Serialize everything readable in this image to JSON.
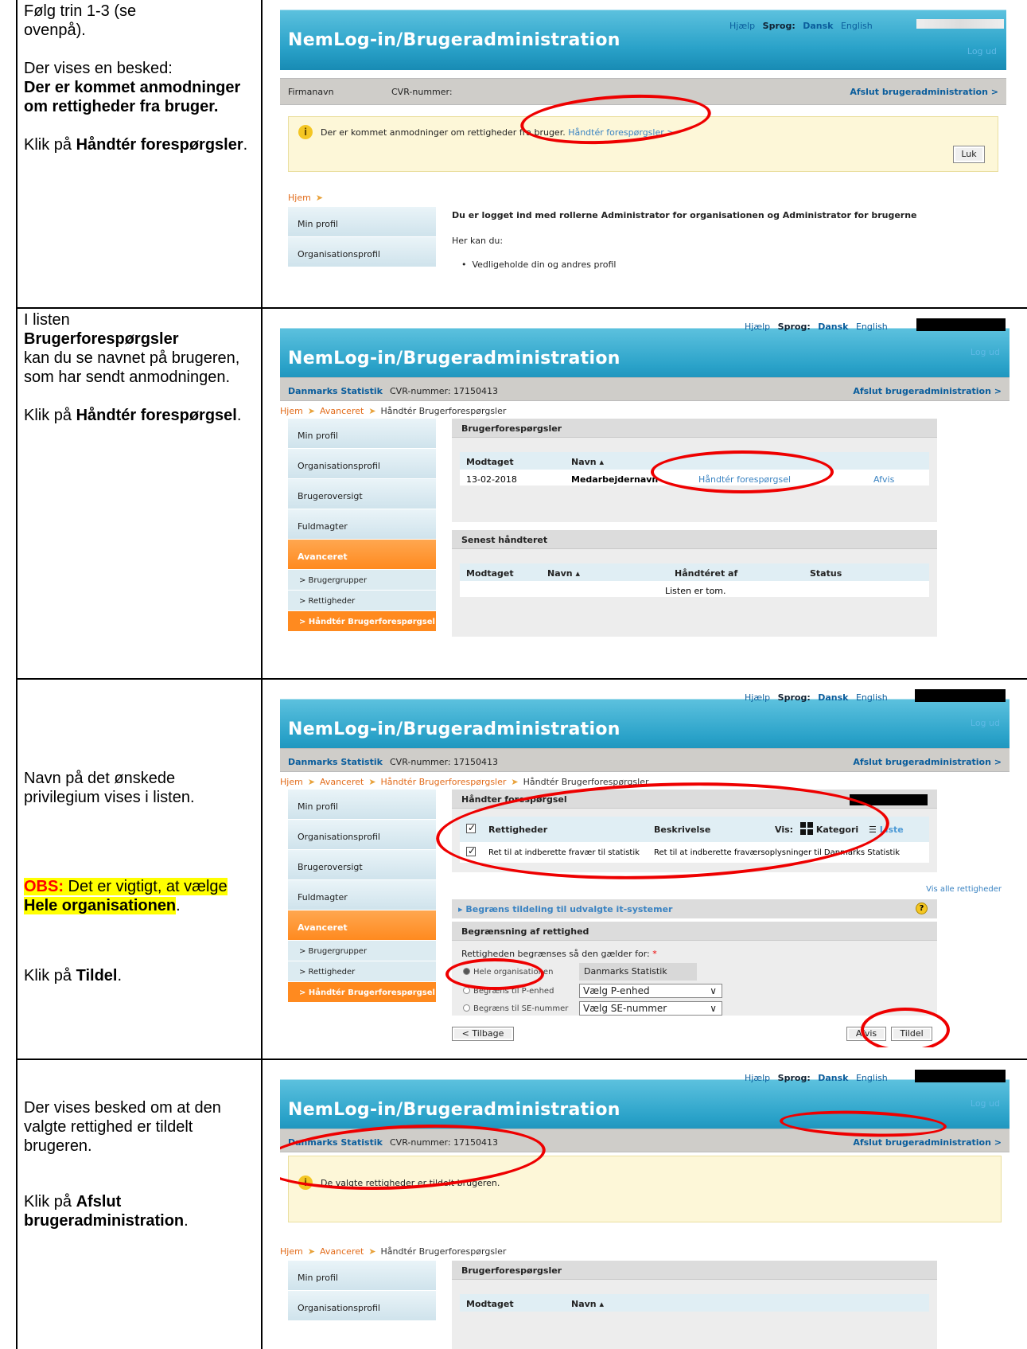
{
  "common": {
    "app_title": "NemLog-in/Brugeradministration",
    "help": "Hjælp",
    "language_label": "Sprog:",
    "lang_dk": "Dansk",
    "lang_en": "English",
    "logout": "Log ud",
    "cvr_label": "CVR-nummer:",
    "exit_admin": "Afslut brugeradministration >",
    "breadcrumb_home": "Hjem",
    "breadcrumb_adv": "Avanceret",
    "breadcrumb_handle": "Håndtér Brugerforespørgsler",
    "nav": {
      "my_profile": "Min profil",
      "org_profile": "Organisationsprofil",
      "user_overview": "Brugeroversigt",
      "mandates": "Fuldmagter",
      "advanced": "Avanceret",
      "groups": "> Brugergrupper",
      "rights": "> Rettigheder",
      "handle_requests": "> Håndtér Brugerforespørgsel"
    }
  },
  "steps": [
    {
      "text_1": "Følg trin 1-3 (se ovenpå).",
      "text_2": "Der vises en besked:",
      "text_3": "Der er kommet anmodninger om rettigheder fra bruger.",
      "text_4a": "Klik på ",
      "text_4b": "Håndtér forespørgsler",
      "text_4c": ".",
      "shot": {
        "org_name": "Firmanavn",
        "info_text": "Der er kommet anmodninger om rettigheder fra bruger.",
        "info_link": "Håndtér forespørgsler >",
        "close_button": "Luk",
        "login_roles": "Du er logget ind med rollerne Administrator for organisationen og Administrator for brugerne",
        "here_you_can": "Her kan du:",
        "bullet_1": "Vedligeholde din og andres profil"
      }
    },
    {
      "text_1": "I listen",
      "text_2": "Brugerforespørgsler",
      "text_3": "kan du se navnet på brugeren, som har sendt anmodningen.",
      "text_4a": "Klik på ",
      "text_4b": "Håndtér forespørgsel",
      "text_4c": ".",
      "shot": {
        "org_name": "Danmarks Statistik",
        "cvr": "CVR-nummer: 17150413",
        "panel1_title": "Brugerforespørgsler",
        "col_received": "Modtaget",
        "col_name": "Navn ▴",
        "row_date": "13-02-2018",
        "row_name": "Medarbejdernavn",
        "row_handle": "Håndtér forespørgsel",
        "row_reject": "Afvis",
        "panel2_title": "Senest håndteret",
        "col_handled_by": "Håndtéret af",
        "col_status": "Status",
        "empty": "Listen er tom."
      }
    },
    {
      "text_1": "Navn på det ønskede privilegium vises i listen.",
      "obs_label": "OBS:",
      "obs_text_1": " Det er vigtigt, at vælge ",
      "obs_bold": "Hele organisationen",
      "obs_text_2": ".",
      "text_4a": "Klik på ",
      "text_4b": "Tildel",
      "text_4c": ".",
      "shot": {
        "org_name": "Danmarks Statistik",
        "cvr": "CVR-nummer: 17150413",
        "panel_title": "Håndter forespørgsel",
        "col_rights": "Rettigheder",
        "col_desc": "Beskrivelse",
        "view_label": "Vis:",
        "view_category": "Kategori",
        "view_list": "Liste",
        "right_name": "Ret til at indberette fravær til statistik",
        "right_desc": "Ret til at indberette fraværsoplysninger til Danmarks Statistik",
        "show_all": "Vis alle rettigheder",
        "limit_systems": "▸ Begræns tildeling til udvalgte it-systemer",
        "limit_title": "Begrænsning af rettighed",
        "limit_text": "Rettigheden begrænses så den gælder for:",
        "opt_whole": "Hele organisationen",
        "opt_p": "Begræns til P-enhed",
        "opt_se": "Begræns til SE-nummer",
        "org_value": "Danmarks Statistik",
        "select_p": "Vælg P-enhed",
        "select_se": "Vælg SE-nummer",
        "back_button": "< Tilbage",
        "reject_button": "Afvis",
        "assign_button": "Tildel"
      }
    },
    {
      "text_1": "Der vises besked om at den valgte rettighed er tildelt brugeren.",
      "text_4a": "Klik på ",
      "text_4b": "Afslut brugeradministration",
      "text_4c": ".",
      "shot": {
        "org_name": "Danmarks Statistik",
        "cvr": "CVR-nummer: 17150413",
        "info_text": "De valgte rettigheder er tildelt brugeren.",
        "panel_title": "Brugerforespørgsler",
        "col_received": "Modtaget",
        "col_name": "Navn ▴"
      }
    }
  ]
}
